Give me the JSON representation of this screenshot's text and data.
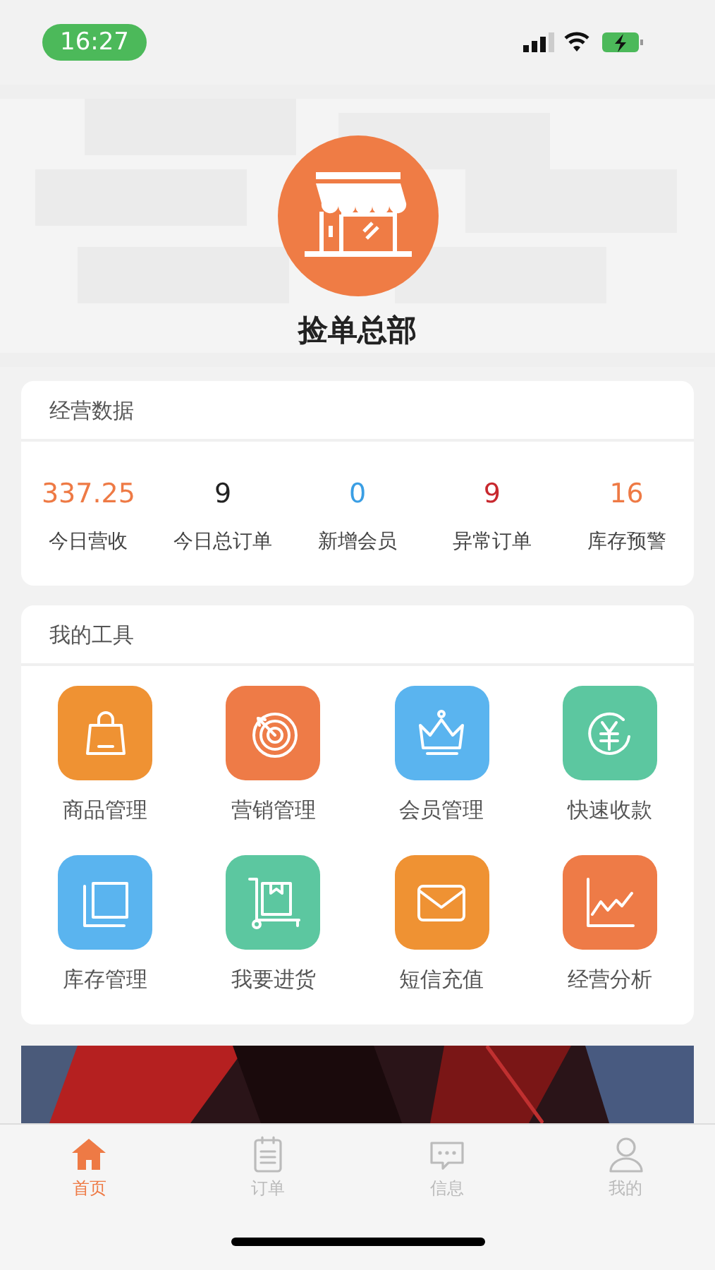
{
  "status_bar": {
    "time": "16:27"
  },
  "store": {
    "name": "捡单总部"
  },
  "business_data": {
    "title": "经营数据",
    "stats": [
      {
        "value": "337.25",
        "label": "今日营收",
        "color": "#ee7a45"
      },
      {
        "value": "9",
        "label": "今日总订单",
        "color": "#222222"
      },
      {
        "value": "0",
        "label": "新增会员",
        "color": "#3a9ee4"
      },
      {
        "value": "9",
        "label": "异常订单",
        "color": "#c8282e"
      },
      {
        "value": "16",
        "label": "库存预警",
        "color": "#ee7a45"
      }
    ]
  },
  "tools": {
    "title": "我的工具",
    "items": [
      {
        "label": "商品管理",
        "kind": "bag",
        "color": "#ef9233"
      },
      {
        "label": "营销管理",
        "kind": "target",
        "color": "#ee7b47"
      },
      {
        "label": "会员管理",
        "kind": "crown",
        "color": "#5ab4ef"
      },
      {
        "label": "快速收款",
        "kind": "yen",
        "color": "#5cc7a0"
      },
      {
        "label": "库存管理",
        "kind": "layers",
        "color": "#5ab4ef"
      },
      {
        "label": "我要进货",
        "kind": "cart",
        "color": "#5cc7a0"
      },
      {
        "label": "短信充值",
        "kind": "mail",
        "color": "#ef9233"
      },
      {
        "label": "经营分析",
        "kind": "chart",
        "color": "#ee7b47"
      }
    ]
  },
  "tab_bar": [
    {
      "label": "首页",
      "kind": "home",
      "selected": true
    },
    {
      "label": "订单",
      "kind": "list",
      "selected": false
    },
    {
      "label": "信息",
      "kind": "chat",
      "selected": false
    },
    {
      "label": "我的",
      "kind": "user",
      "selected": false
    }
  ]
}
